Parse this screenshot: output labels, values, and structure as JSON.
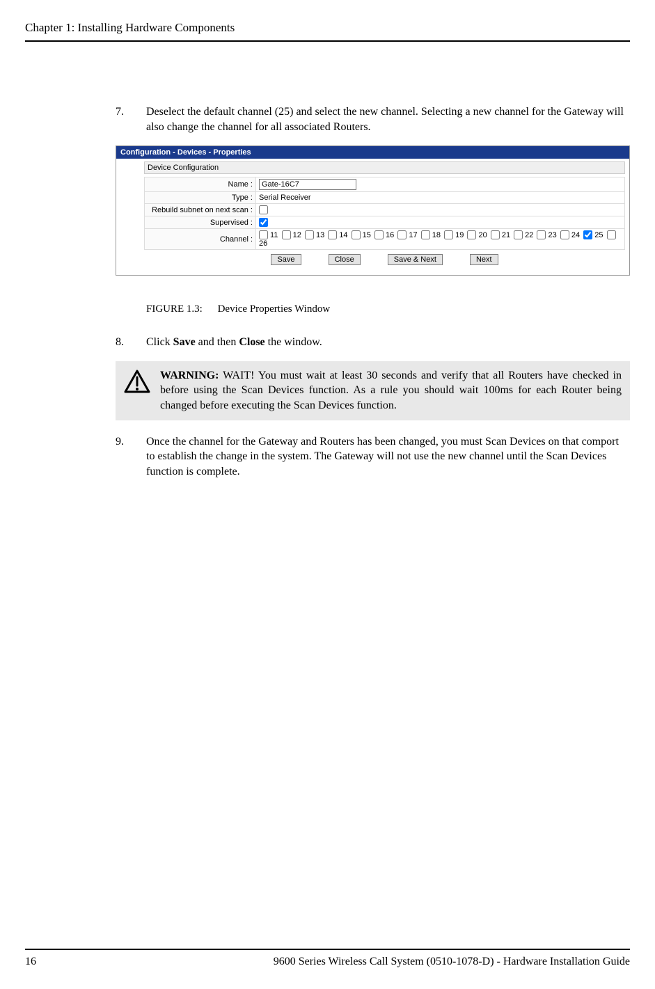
{
  "header": "Chapter 1: Installing Hardware Components",
  "steps": {
    "s7": {
      "num": "7.",
      "text": "Deselect the default channel (25) and select the new channel. Selecting a new channel for the Gateway will also change the channel for all associated Routers."
    },
    "s8": {
      "num": "8.",
      "pre": "Click ",
      "b1": "Save",
      "mid": " and then ",
      "b2": "Close",
      "post": " the window."
    },
    "s9": {
      "num": "9.",
      "text": "Once the channel for the Gateway and Routers has been changed, you must Scan Devices on that comport to establish the change in the system. The Gateway will not use the new channel until the Scan Devices function is complete."
    }
  },
  "config": {
    "titlebar": "Configuration - Devices - Properties",
    "subtitle": "Device Configuration",
    "rows": {
      "name": {
        "label": "Name :",
        "value": "Gate-16C7"
      },
      "type": {
        "label": "Type :",
        "value": "Serial Receiver"
      },
      "rebuild": {
        "label": "Rebuild subnet on next scan :"
      },
      "supervised": {
        "label": "Supervised :"
      },
      "channel": {
        "label": "Channel :"
      }
    },
    "channels": [
      "11",
      "12",
      "13",
      "14",
      "15",
      "16",
      "17",
      "18",
      "19",
      "20",
      "21",
      "22",
      "23",
      "24",
      "25",
      "26"
    ],
    "checked_channel": "25",
    "buttons": {
      "save": "Save",
      "close": "Close",
      "savenext": "Save & Next",
      "next": "Next"
    }
  },
  "figure": {
    "num": "FIGURE 1.3:",
    "caption": "Device Properties Window"
  },
  "warning": {
    "label": "WARNING:",
    "text": " WAIT! You must wait at least 30 seconds and verify that all Routers have checked in before using the Scan Devices function. As a rule you should wait 100ms for each Router being changed before executing the Scan Devices function."
  },
  "footer": {
    "page": "16",
    "doc": "9600 Series Wireless Call System (0510-1078-D) - Hardware Installation Guide"
  }
}
